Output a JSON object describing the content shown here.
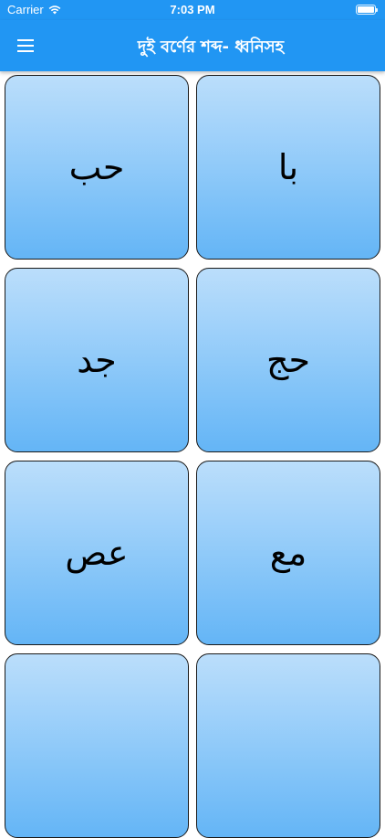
{
  "status_bar": {
    "carrier": "Carrier",
    "time": "7:03 PM"
  },
  "app_bar": {
    "title": "দুই বর্ণের শব্দ- ধ্বনিসহ",
    "background": "#2196f3"
  },
  "cards": [
    {
      "word": "حب"
    },
    {
      "word": "با"
    },
    {
      "word": "جد"
    },
    {
      "word": "حج"
    },
    {
      "word": "عص"
    },
    {
      "word": "مع"
    },
    {
      "word": ""
    },
    {
      "word": ""
    }
  ]
}
